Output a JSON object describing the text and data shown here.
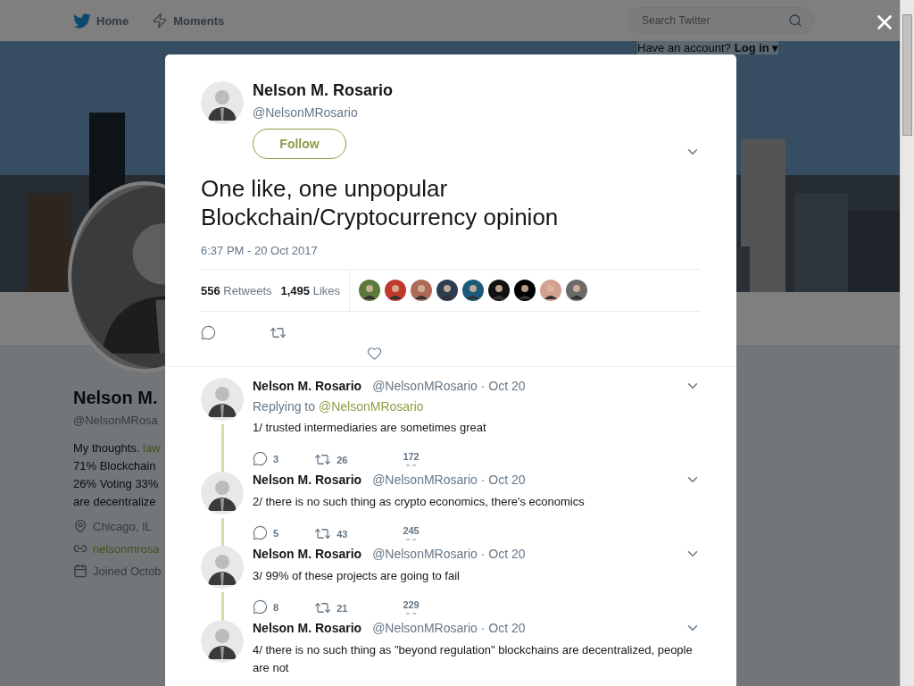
{
  "topbar": {
    "nav": [
      "Home",
      "Moments"
    ],
    "search": {
      "placeholder": "Search Twitter"
    },
    "account_prompt": "Have an account?",
    "login": "Log in",
    "login_caret": "▾"
  },
  "profile": {
    "name": "Nelson M.",
    "handle": "@NelsonMRosa",
    "bio": [
      {
        "text": "My thoughts.",
        "link": "law"
      },
      {
        "text": "71% Blockchain"
      },
      {
        "text": "26% Voting 33%"
      },
      {
        "text": "are decentralize"
      }
    ],
    "location": "Chicago, IL",
    "website": "nelsonmrosa",
    "joined": "Joined Octob"
  },
  "tweet": {
    "name": "Nelson M. Rosario",
    "handle": "@NelsonMRosario",
    "follow": "Follow",
    "text": "One like, one unpopular Blockchain/Cryptocurrency opinion",
    "time": "6:37 PM - 20 Oct 2017",
    "retweets": "556",
    "retweets_label": "Retweets",
    "likes": "1,495",
    "likes_label": "Likes",
    "likers": [
      {
        "color": "#5a7a3a"
      },
      {
        "color": "#c0392b"
      },
      {
        "color": "#b06a5a"
      },
      {
        "color": "#2c3e50"
      },
      {
        "color": "#1a5b7a"
      },
      {
        "color": "#111111"
      },
      {
        "color": "#000000"
      },
      {
        "color": "#d4a090"
      },
      {
        "color": "#6a6a6a"
      }
    ]
  },
  "replies": [
    {
      "name": "Nelson M. Rosario",
      "handle": "@NelsonMRosario",
      "separator": "·",
      "date": "Oct 20",
      "replying_label": "Replying to",
      "replying_to": "@NelsonMRosario",
      "text": "1/ trusted intermediaries are sometimes great",
      "replies": "3",
      "retweets": "26",
      "likes": "172"
    },
    {
      "name": "Nelson M. Rosario",
      "handle": "@NelsonMRosario",
      "separator": "·",
      "date": "Oct 20",
      "text": "2/ there is no such thing as crypto economics, there's economics",
      "replies": "5",
      "retweets": "43",
      "likes": "245"
    },
    {
      "name": "Nelson M. Rosario",
      "handle": "@NelsonMRosario",
      "separator": "·",
      "date": "Oct 20",
      "text": "3/ 99% of these projects are going to fail",
      "replies": "8",
      "retweets": "21",
      "likes": "229"
    },
    {
      "name": "Nelson M. Rosario",
      "handle": "@NelsonMRosario",
      "separator": "·",
      "date": "Oct 20",
      "text": "4/ there is no such thing as \"beyond regulation\" blockchains are decentralized, people are not"
    }
  ]
}
